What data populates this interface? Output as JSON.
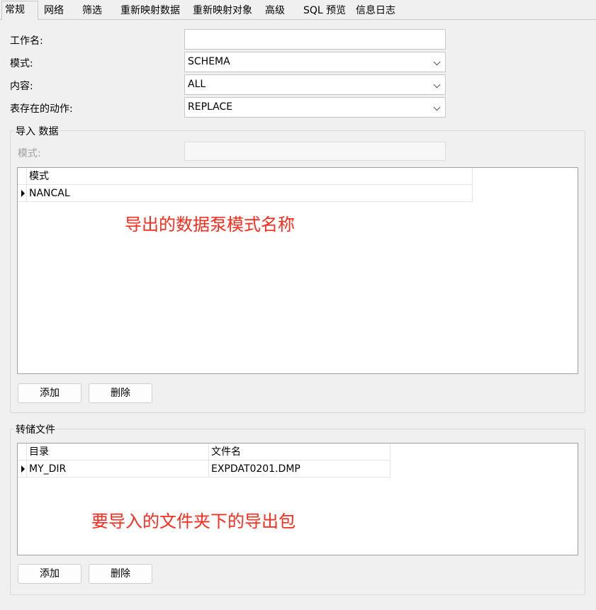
{
  "tabs": [
    {
      "label": "常规",
      "active": true
    },
    {
      "label": "网络"
    },
    {
      "label": "筛选"
    },
    {
      "label": "重新映射数据"
    },
    {
      "label": "重新映射对象"
    },
    {
      "label": "高级"
    },
    {
      "label": "SQL 预览"
    },
    {
      "label": "信息日志"
    }
  ],
  "form": {
    "job_name_label": "工作名:",
    "job_name_value": "",
    "mode_label": "模式:",
    "mode_value": "SCHEMA",
    "content_label": "内容:",
    "content_value": "ALL",
    "table_exists_label": "表存在的动作:",
    "table_exists_value": "REPLACE"
  },
  "import_group": {
    "title": "导入 数据",
    "schema_label": "模式:",
    "schema_value": "",
    "grid_header": "模式",
    "rows": [
      "NANCAL"
    ],
    "add_label": "添加",
    "delete_label": "删除",
    "annotation": "导出的数据泵模式名称"
  },
  "dump_group": {
    "title": "转储文件",
    "col_dir": "目录",
    "col_file": "文件名",
    "rows": [
      {
        "dir": "MY_DIR",
        "file": "EXPDAT0201.DMP"
      }
    ],
    "add_label": "添加",
    "delete_label": "删除",
    "annotation": "要导入的文件夹下的导出包"
  },
  "colors": {
    "annotation": "#ff2a1a",
    "background": "#f0f0f0"
  }
}
